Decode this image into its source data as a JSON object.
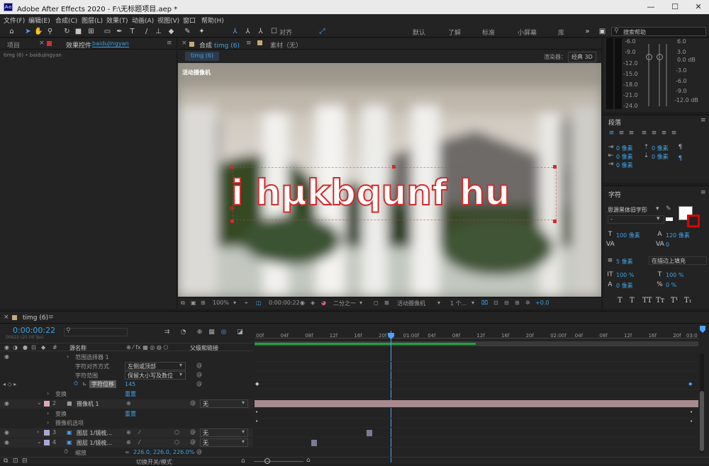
{
  "app": {
    "title": "Adobe After Effects 2020 - F:\\无标题项目.aep *"
  },
  "menu": [
    "文件(F)",
    "编辑(E)",
    "合成(C)",
    "图层(L)",
    "效果(T)",
    "动画(A)",
    "视图(V)",
    "窗口",
    "帮助(H)"
  ],
  "toolbar": {
    "align_label": "对齐",
    "workspaces": [
      "默认",
      "了解",
      "标准",
      "小屏幕",
      "库"
    ],
    "search_placeholder": "搜索帮助"
  },
  "left_panel": {
    "tab_project": "项目",
    "tab_effects": "效果控件",
    "effects_layer": "baidujingyan",
    "breadcrumb": "timg (6) • baidujingyan"
  },
  "comp_panel": {
    "tab_label": "合成",
    "tab_name": "timg (6)",
    "footage_tab": "素材（无）",
    "comp_button": "timg (6)",
    "renderer_label": "渲染器：",
    "renderer_value": "经典 3D",
    "camera_label": "活动摄像机",
    "overlay_text": "i hμkbqunf hu",
    "bottom": {
      "zoom": "100%",
      "time": "0:00:00:22",
      "resolution": "二分之一",
      "view": "活动摄像机",
      "views_count": "1 个...",
      "exposure": "+0.0"
    }
  },
  "audio": {
    "left_levels": [
      "-6.0",
      "-9.0",
      "-12.0",
      "-15.0",
      "-18.0",
      "-21.0",
      "-24.0"
    ],
    "right_levels": [
      "6.0",
      "3.0",
      "0.0 dB",
      "-3.0",
      "-6.0",
      "-9.0",
      "-12.0 dB"
    ]
  },
  "paragraph": {
    "title": "段落",
    "values": [
      "0 像素",
      "0 像素",
      "0 像素",
      "0 像素",
      "0 像素"
    ]
  },
  "character": {
    "title": "字符",
    "font": "思源黑体旧字形",
    "style": "-",
    "size": "100 像素",
    "leading": "120 像素",
    "tracking": "0",
    "stroke_width": "5 像素",
    "stroke_mode": "在描边上填充",
    "vert_scale": "100 %",
    "horiz_scale": "100 %",
    "baseline": "0 像素",
    "tsume": "0 %",
    "fill_color": "#ffffff",
    "stroke_color": "#e00000"
  },
  "timeline": {
    "tab": "timg (6)",
    "timecode": "0:00:00:22",
    "timecode_sub": "00022 (25.00 fps)",
    "col_source": "源名称",
    "col_parent": "父级和链接",
    "ticks": [
      "00f",
      "04f",
      "08f",
      "12f",
      "16f",
      "20f",
      "01:00f",
      "04f",
      "08f",
      "12f",
      "16f",
      "20f",
      "02:00f",
      "04f",
      "08f",
      "12f",
      "16f",
      "20f",
      "03:0"
    ],
    "footer": "切换开关/模式",
    "rows": [
      {
        "indent": 2,
        "label": "范围选择器 1"
      },
      {
        "indent": 3,
        "label": "字符对齐方式",
        "value": "左侧或顶部"
      },
      {
        "indent": 3,
        "label": "字符范围",
        "value": "保留大小写及数位"
      },
      {
        "indent": 3,
        "label": "字符位移",
        "value": "145"
      },
      {
        "indent": 1,
        "label": "变换",
        "value": "重置"
      },
      {
        "num": "2",
        "label": "摄像机 1",
        "parent": "无"
      },
      {
        "indent": 1,
        "label": "变换",
        "value": "重置"
      },
      {
        "indent": 1,
        "label": "摄像机选项"
      },
      {
        "num": "3",
        "label": "图层 1/镜梳...",
        "parent": "无"
      },
      {
        "num": "4",
        "label": "图层 1/镜梳...",
        "parent": "无"
      },
      {
        "indent": 2,
        "label": "缩放",
        "value": "226.0, 226.0, 226.0%"
      }
    ]
  }
}
